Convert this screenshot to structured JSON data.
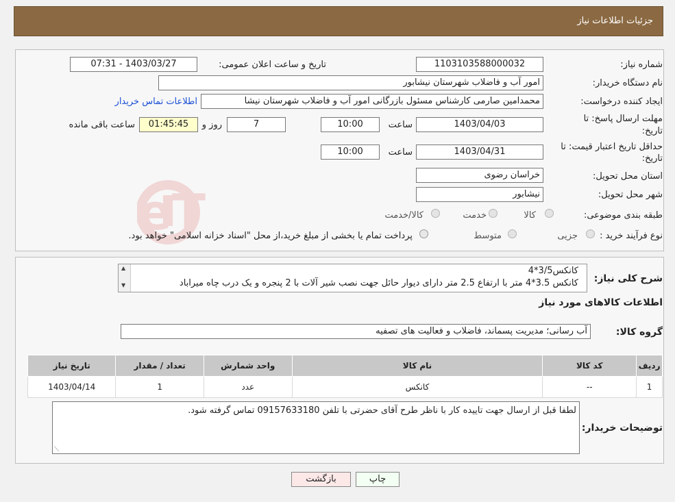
{
  "header": {
    "title": "جزئیات اطلاعات نیاز"
  },
  "watermark": {
    "text": "AriaTender.neT"
  },
  "info": {
    "need_number_label": "شماره نیاز:",
    "need_number": "1103103588000032",
    "announce_label": "تاریخ و ساعت اعلان عمومی:",
    "announce_value": "1403/03/27 - 07:31",
    "buyer_org_label": "نام دستگاه خریدار:",
    "buyer_org": "امور آب و فاضلاب شهرستان نیشابور",
    "creator_label": "ایجاد کننده درخواست:",
    "creator": "محمدامین صارمی کارشناس مسئول بازرگانی امور آب و فاضلاب شهرستان نیشا",
    "contact_link": "اطلاعات تماس خریدار",
    "deadline_label_1": "مهلت ارسال پاسخ: تا",
    "deadline_label_2": "تاریخ:",
    "deadline_date": "1403/04/03",
    "time_word": "ساعت",
    "deadline_time": "10:00",
    "days_value": "7",
    "days_word": "روز و",
    "remaining_time": "01:45:45",
    "remaining_word": "ساعت باقی مانده",
    "validity_label_1": "حداقل تاریخ اعتبار قیمت: تا",
    "validity_label_2": "تاریخ:",
    "validity_date": "1403/04/31",
    "validity_time": "10:00",
    "province_label": "استان محل تحویل:",
    "province": "خراسان رضوی",
    "city_label": "شهر محل تحویل:",
    "city": "نیشابور",
    "category_label": "طبقه بندی موضوعی:",
    "category_options": [
      "کالا",
      "خدمت",
      "کالا/خدمت"
    ],
    "process_label": "نوع فرآیند خرید :",
    "process_options": [
      "جزیی",
      "متوسط"
    ],
    "process_note": "پرداخت تمام یا بخشی از مبلغ خرید،از محل \"اسناد خزانه اسلامی\" خواهد بود."
  },
  "details": {
    "desc_label": "شرح کلی نیاز:",
    "desc_line1": "کانکس3/5*4",
    "desc_line2": "کانکس 3.5*4 متر با ارتفاع 2.5 متر دارای دیوار حائل جهت نصب شیر آلات با 2 پنجره و یک درب چاه میراباد",
    "goods_info_title": "اطلاعات کالاهای مورد نیاز",
    "group_label": "گروه کالا:",
    "group_value": "آب رسانی؛ مدیریت پسماند، فاضلاب و فعالیت های تصفیه",
    "table": {
      "headers": [
        "ردیف",
        "کد کالا",
        "نام کالا",
        "واحد شمارش",
        "تعداد / مقدار",
        "تاریخ نیاز"
      ],
      "rows": [
        [
          "1",
          "--",
          "کانکس",
          "عدد",
          "1",
          "1403/04/14"
        ]
      ]
    },
    "buyer_notes_label": "توضیحات خریدار:",
    "buyer_notes": "لطفا قبل از ارسال جهت تاییده کار با ناظر طرح آقای حضرتی با تلفن 09157633180 تماس گرفته شود."
  },
  "buttons": {
    "print": "چاپ",
    "back": "بازگشت"
  }
}
